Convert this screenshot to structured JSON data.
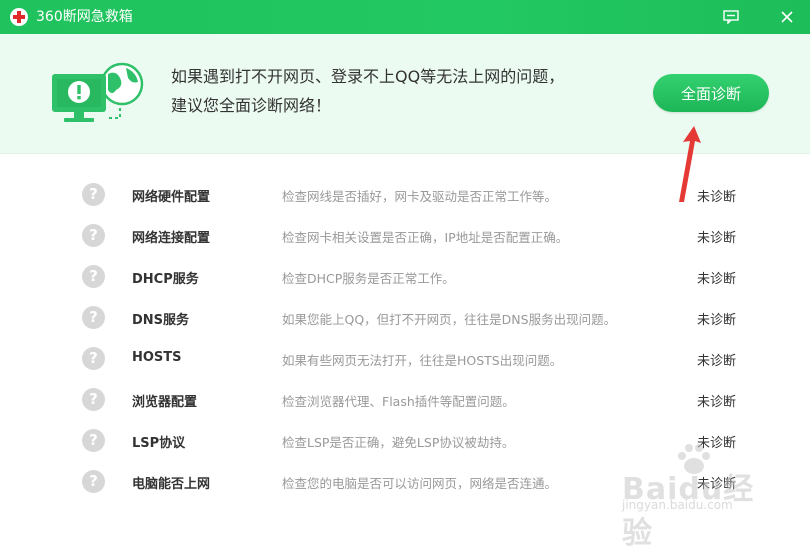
{
  "window": {
    "title": "360断网急救箱"
  },
  "banner": {
    "line1": "如果遇到打不开网页、登录不上QQ等无法上网的问题，",
    "line2": "建议您全面诊断网络！",
    "button_label": "全面诊断"
  },
  "items": [
    {
      "name": "网络硬件配置",
      "desc": "检查网线是否插好，网卡及驱动是否正常工作等。",
      "status": "未诊断"
    },
    {
      "name": "网络连接配置",
      "desc": "检查网卡相关设置是否正确，IP地址是否配置正确。",
      "status": "未诊断"
    },
    {
      "name": "DHCP服务",
      "desc": "检查DHCP服务是否正常工作。",
      "status": "未诊断"
    },
    {
      "name": "DNS服务",
      "desc": "如果您能上QQ，但打不开网页，往往是DNS服务出现问题。",
      "status": "未诊断"
    },
    {
      "name": "HOSTS",
      "desc": "如果有些网页无法打开，往往是HOSTS出现问题。",
      "status": "未诊断"
    },
    {
      "name": "浏览器配置",
      "desc": "检查浏览器代理、Flash插件等配置问题。",
      "status": "未诊断"
    },
    {
      "name": "LSP协议",
      "desc": "检查LSP是否正确，避免LSP协议被劫持。",
      "status": "未诊断"
    },
    {
      "name": "电脑能否上网",
      "desc": "检查您的电脑是否可以访问网页，网络是否连通。",
      "status": "未诊断"
    }
  ],
  "item_icon_glyph": "?",
  "watermark": {
    "text": "Baidu经验",
    "sub": "jingyan.baidu.com"
  },
  "colors": {
    "brand_green": "#22c862",
    "banner_bg": "#ecfbf1",
    "arrow_red": "#e53935"
  }
}
